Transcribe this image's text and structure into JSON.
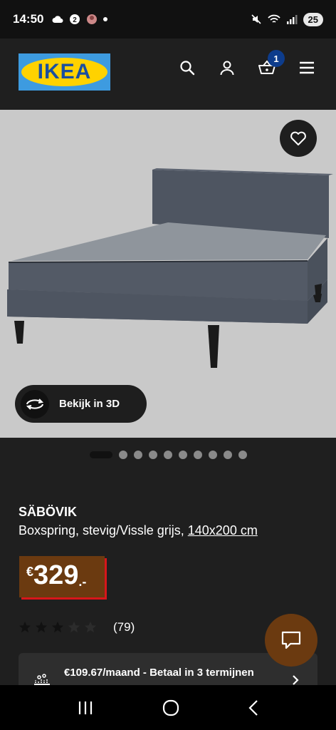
{
  "status_bar": {
    "time": "14:50",
    "battery": "25"
  },
  "header": {
    "logo_text": "IKEA",
    "cart_count": "1",
    "icons": [
      "search-icon",
      "user-icon",
      "cart-icon",
      "menu-icon"
    ]
  },
  "product": {
    "name": "SÄBÖVIK",
    "description": "Boxspring, stevig/Vissle grijs, ",
    "size": "140x200 cm",
    "view3d_label": "Bekijk in 3D",
    "price": {
      "currency": "€",
      "integer": "329",
      "decimal": ".-"
    },
    "rating": {
      "stars": 3,
      "max": 5,
      "count": "(79)"
    },
    "image_count": 10,
    "active_image": 0
  },
  "payment": {
    "text": "€109.67/maand - Betaal in 3 termijnen"
  },
  "colors": {
    "background": "#1f1f1f",
    "price_bg": "#6b3a10",
    "price_shadow": "#d8161b",
    "ikea_blue": "#3d9be0",
    "ikea_yellow": "#ffd200",
    "badge_blue": "#0d3c8c"
  }
}
